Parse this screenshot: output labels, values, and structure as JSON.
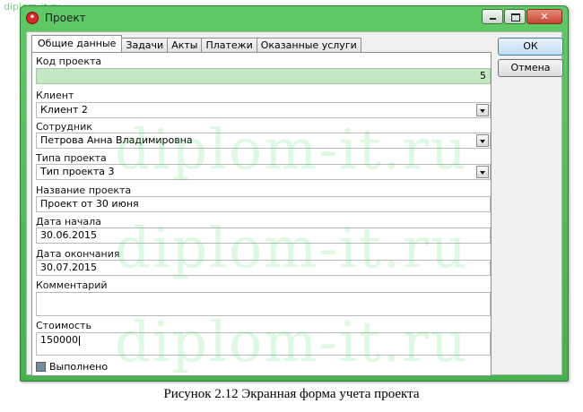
{
  "site_mark": "diplom-it.ru",
  "window": {
    "title": "Проект"
  },
  "tabs": [
    {
      "label": "Общие данные",
      "active": true
    },
    {
      "label": "Задачи"
    },
    {
      "label": "Акты"
    },
    {
      "label": "Платежи"
    },
    {
      "label": "Оказанные услуги"
    }
  ],
  "form": {
    "project_code": {
      "label": "Код проекта",
      "value": "5"
    },
    "client": {
      "label": "Клиент",
      "value": "Клиент 2"
    },
    "employee": {
      "label": "Сотрудник",
      "value": "Петрова Анна Владимировна"
    },
    "project_type": {
      "label": "Типа проекта",
      "value": "Тип проекта 3"
    },
    "project_name": {
      "label": "Название проекта",
      "value": "Проект от 30 июня"
    },
    "start_date": {
      "label": "Дата начала",
      "value": "30.06.2015"
    },
    "end_date": {
      "label": "Дата окончания",
      "value": "30.07.2015"
    },
    "comment": {
      "label": "Комментарий",
      "value": ""
    },
    "cost": {
      "label": "Стоимость",
      "value": "150000"
    },
    "done": {
      "label": "Выполнено",
      "checked": true
    }
  },
  "buttons": {
    "ok": "ОК",
    "cancel": "Отмена"
  },
  "watermark": "diplom-it.ru",
  "caption": "Рисунок 2.12 Экранная форма учета проекта",
  "colors": {
    "title_bar": "#4cb554",
    "readonly_field": "#c5e8c4",
    "watermark": "#3cdc5a"
  }
}
